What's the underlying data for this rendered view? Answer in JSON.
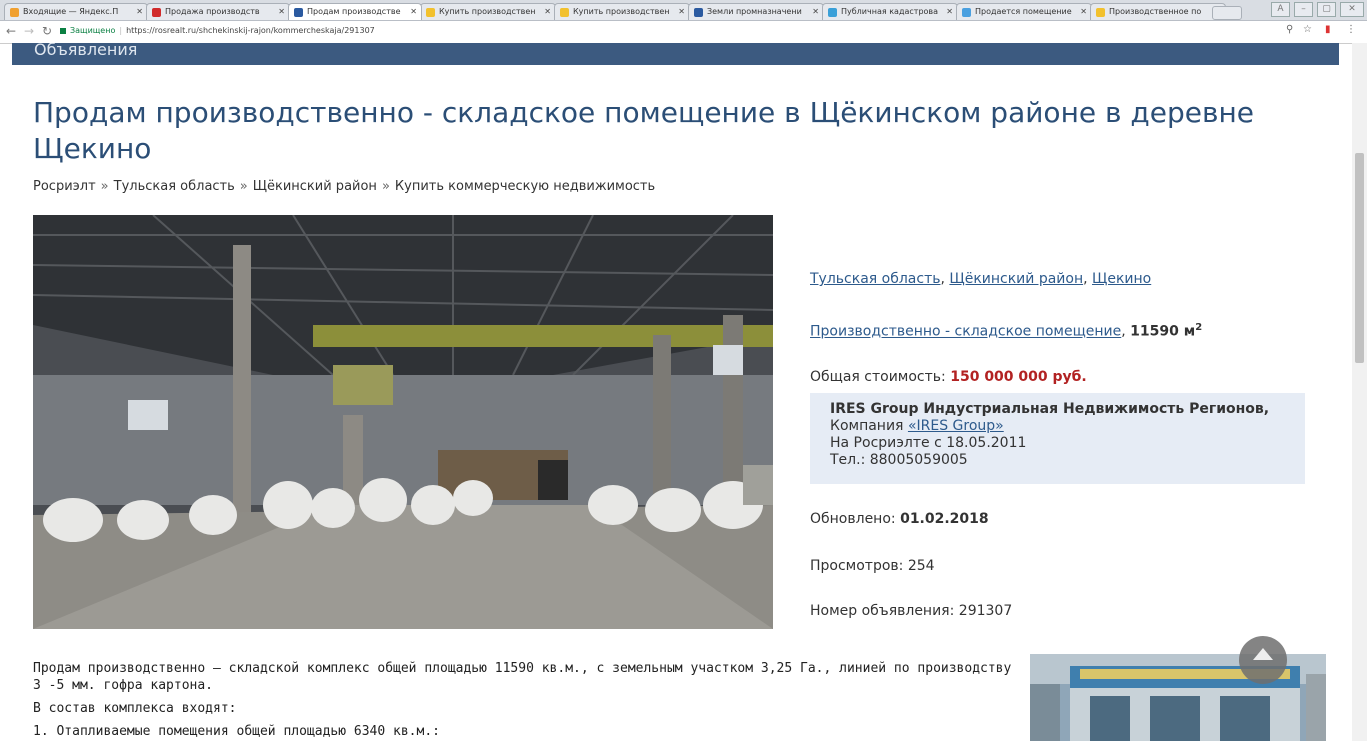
{
  "browser": {
    "tabs": [
      {
        "label": "Входящие — Яндекс.П",
        "color": "#f0a030"
      },
      {
        "label": "Продажа производств",
        "color": "#d12b2b"
      },
      {
        "label": "Продам производстве",
        "color": "#2b5aa0"
      },
      {
        "label": "Купить производствен",
        "color": "#f2c12e"
      },
      {
        "label": "Купить производствен",
        "color": "#f2c12e"
      },
      {
        "label": "Земли промназначени",
        "color": "#2b5aa0"
      },
      {
        "label": "Публичная кадастрова",
        "color": "#3aa0d8"
      },
      {
        "label": "Продается помещение",
        "color": "#4aa0e0"
      },
      {
        "label": "Производственное по",
        "color": "#f2c12e"
      }
    ],
    "secure_label": "Защищено",
    "url": "https://rosrealt.ru/shchekinskij-rajon/kommercheskaja/291307"
  },
  "header": {
    "banner_text": "Объявления"
  },
  "listing": {
    "title": "Продам производственно - складское помещение в Щёкинском районе в деревне Щекино",
    "breadcrumbs": [
      "Росриэлт",
      "Тульская область",
      "Щёкинский район",
      "Купить коммерческую недвижимость"
    ],
    "location": {
      "region": "Тульская область",
      "district": "Щёкинский район",
      "town": "Щекино"
    },
    "property_type": "Производственно - складское помещение",
    "area": "11590 м",
    "area_sup": "2",
    "price_label": "Общая стоимость:",
    "price": "150 000 000 руб.",
    "agent": {
      "name": "IRES Group Индустриальная Недвижимость Регионов,",
      "company_prefix": "Компания",
      "company_link": "«IRES Group»",
      "since": "На Росриэлте с 18.05.2011",
      "phone": "Тел.: 88005059005"
    },
    "updated_label": "Обновлено:",
    "updated": "01.02.2018",
    "views_label": "Просмотров:",
    "views": "254",
    "number_label": "Номер объявления:",
    "number": "291307",
    "description": [
      "Продам производственно – складской комплекс общей площадью 11590 кв.м., с земельным участком 3,25 Га., линией по производству 3 -5 мм. гофра картона.",
      "В состав комплекса входят:",
      "1. Отапливаемые помещения общей площадью 6340 кв.м.:"
    ]
  }
}
